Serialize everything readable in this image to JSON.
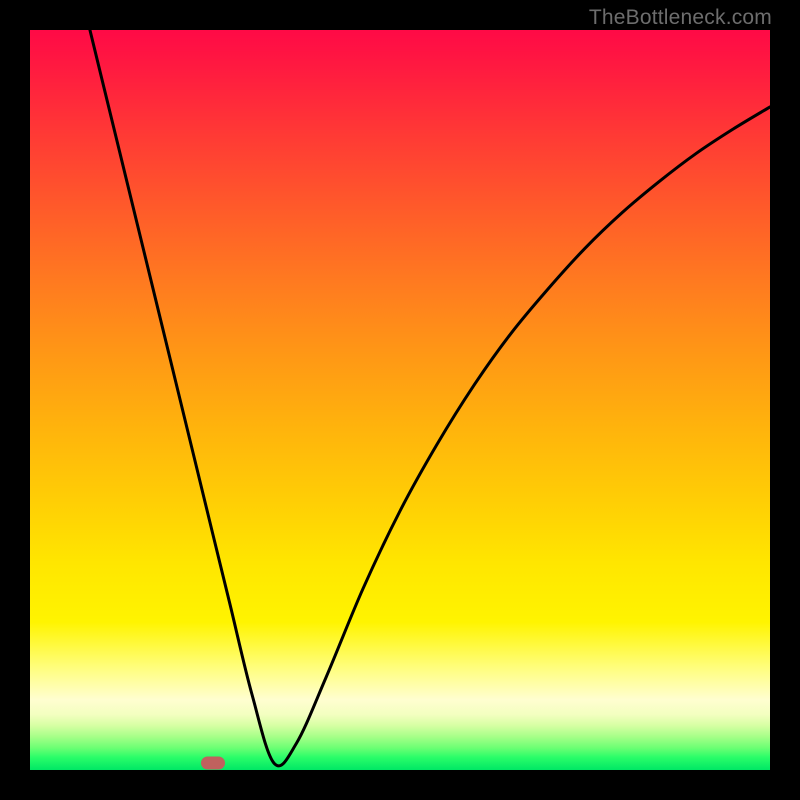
{
  "watermark": "TheBottleneck.com",
  "chart_data": {
    "type": "line",
    "title": "",
    "xlabel": "",
    "ylabel": "",
    "xlim": [
      0,
      100
    ],
    "ylim": [
      0,
      100
    ],
    "grid": false,
    "legend": false,
    "background_gradient": [
      "#ff0a46",
      "#ff9815",
      "#ffe600",
      "#fffed0",
      "#00e765"
    ],
    "series": [
      {
        "name": "bottleneck-curve",
        "color": "#000000",
        "x": [
          8.1,
          10,
          13,
          16,
          19,
          22,
          24.7,
          27,
          30,
          33,
          36,
          40,
          45,
          50,
          55,
          60,
          65,
          70,
          75,
          80,
          85,
          90,
          95,
          100
        ],
        "y": [
          100,
          92.2,
          79.9,
          67.6,
          55.3,
          43,
          31.9,
          22.5,
          10.2,
          0.9,
          3.6,
          12.5,
          24.5,
          35,
          44,
          52,
          59,
          65,
          70.5,
          75.3,
          79.5,
          83.3,
          86.6,
          89.6
        ]
      }
    ],
    "marker": {
      "name": "optimal-point",
      "x": 24.7,
      "y": 0.9,
      "color": "#c0615e",
      "shape": "pill"
    }
  }
}
